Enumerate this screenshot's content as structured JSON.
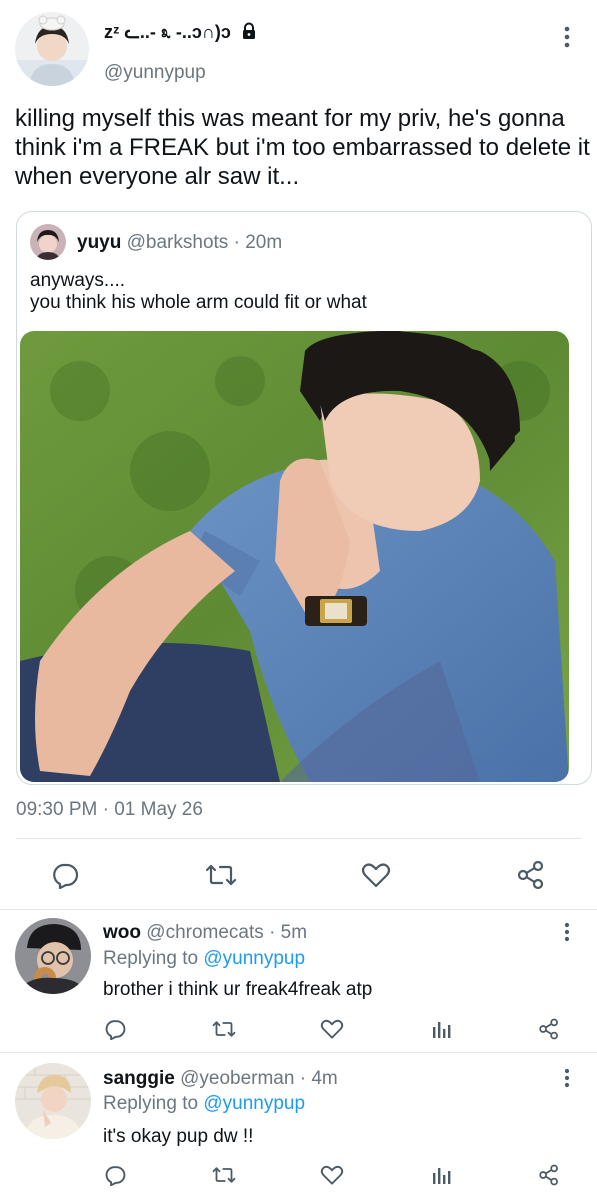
{
  "tweet": {
    "display_name": "zᶻ ᓚ..- ೩ -..ɔ∩)ɔ",
    "handle": "@yunnypup",
    "text": "killing myself this was meant for my priv, he's gonna think i'm a FREAK but i'm too embarrassed to delete it when everyone alr saw it...",
    "timestamp": "09:30 PM · 01 May 26",
    "avatar": "white-bear-headband-selfie"
  },
  "quote": {
    "name": "yuyu",
    "handle": "@barkshots",
    "time_sep": "·",
    "time": "20m",
    "text_line1": "anyways....",
    "text_line2": "you think his whole arm could fit or what",
    "media": "man-in-denim-shirt-sitting-on-grass",
    "avatar": "dark-haired-selfie"
  },
  "actions": [
    "reply-icon",
    "retweet-icon",
    "like-icon",
    "share-icon"
  ],
  "replies": [
    {
      "name": "woo",
      "handle": "@chromecats",
      "time_sep": "·",
      "time": "5m",
      "replying_prefix": "Replying to",
      "replying_to": "@yunnypup",
      "text": "brother i think ur freak4freak atp",
      "avatar": "beanie-glasses-donut"
    },
    {
      "name": "sanggie",
      "handle": "@yeoberman",
      "time_sep": "·",
      "time": "4m",
      "replying_prefix": "Replying to",
      "replying_to": "@yunnypup",
      "text": "it's okay pup dw !!",
      "avatar": "light-hair-brick-wall"
    }
  ],
  "colors": {
    "text": "#0f1419",
    "secondary": "#6b7780",
    "link": "#1d9bf0",
    "icon": "#4b5a66",
    "divider": "#e1e8ed"
  }
}
